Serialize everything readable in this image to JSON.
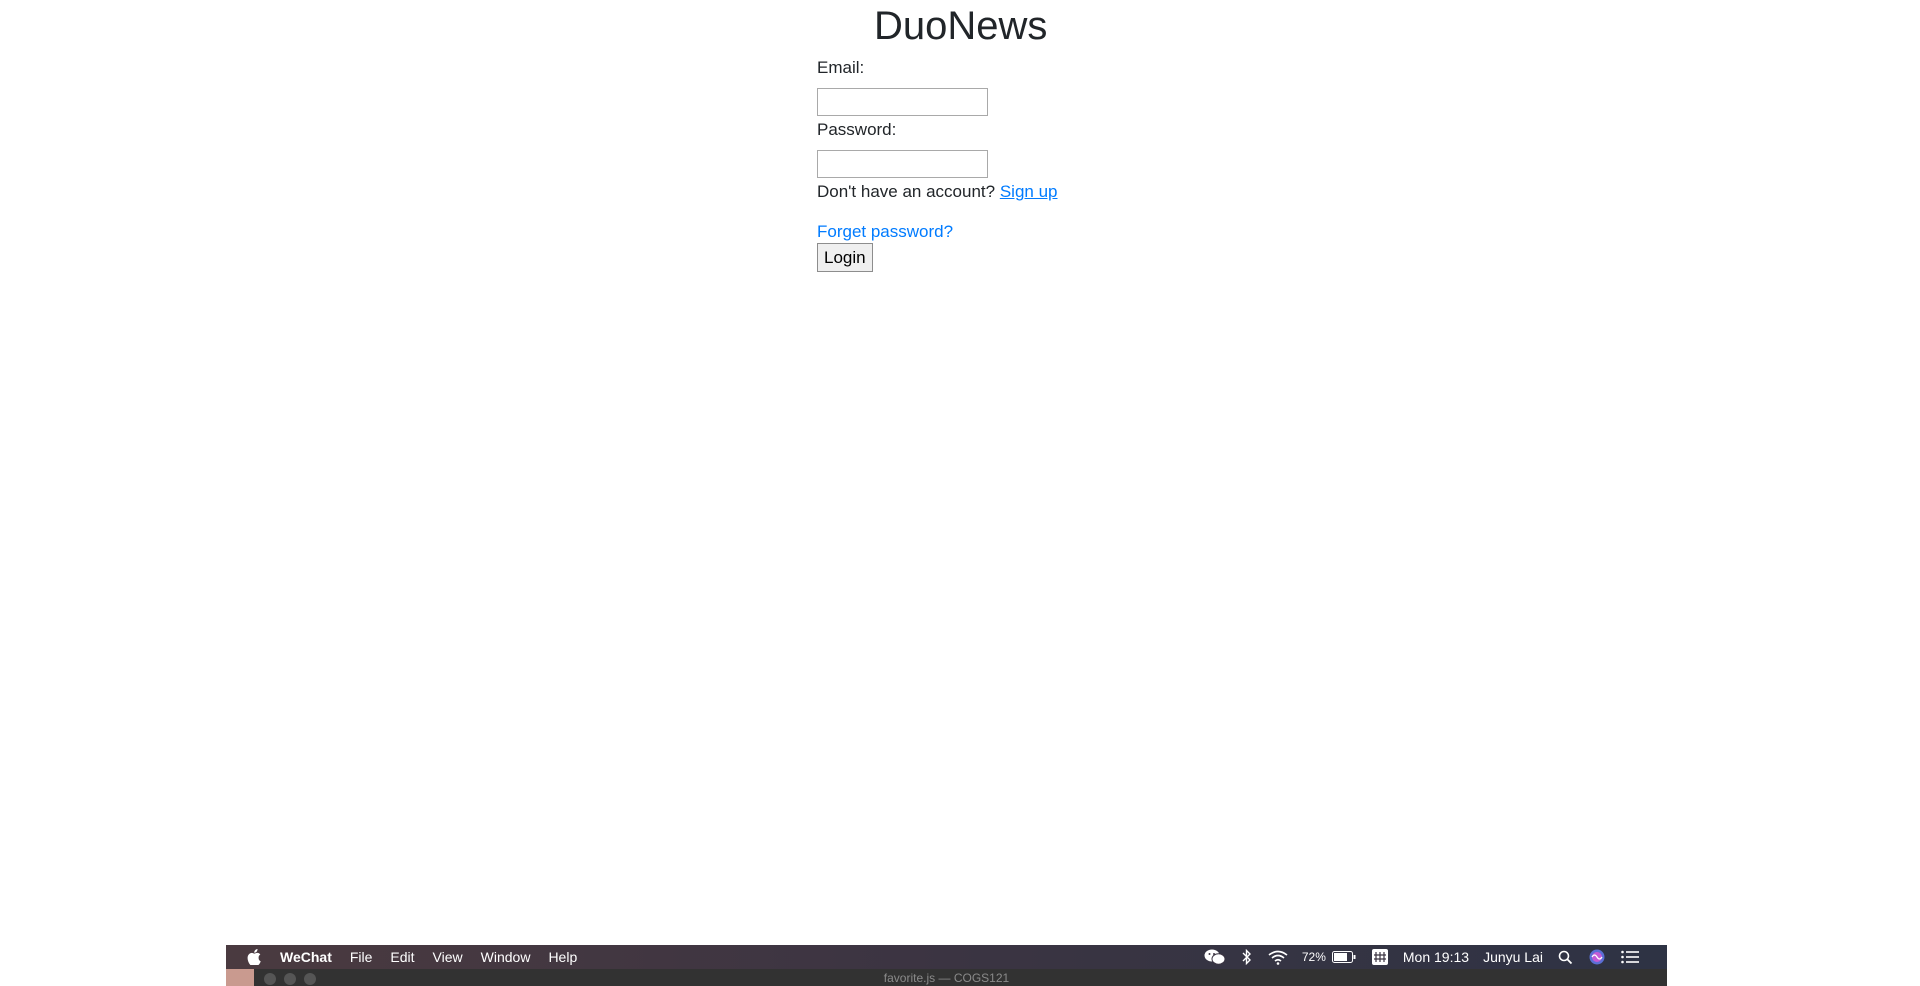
{
  "app": {
    "title": "DuoNews"
  },
  "form": {
    "email_label": "Email:",
    "email_value": "",
    "password_label": "Password:",
    "password_value": "",
    "signup_prompt": "Don't have an account?",
    "signup_link": "Sign up",
    "forgot_link": "Forget password?",
    "login_button": "Login"
  },
  "menubar": {
    "app_name": "WeChat",
    "menus": [
      "File",
      "Edit",
      "View",
      "Window",
      "Help"
    ],
    "battery_percent": "72%",
    "clock": "Mon 19:13",
    "user": "Junyu Lai",
    "icons": [
      "apple-icon",
      "wechat-icon",
      "bluetooth-icon",
      "wifi-icon",
      "battery-icon",
      "input-method-icon",
      "search-icon",
      "siri-icon",
      "notification-center-icon"
    ]
  },
  "window": {
    "title": "favorite.js — COGS121"
  },
  "colors": {
    "link": "#007bff",
    "text": "#212529",
    "menubar": "#3b3442"
  }
}
